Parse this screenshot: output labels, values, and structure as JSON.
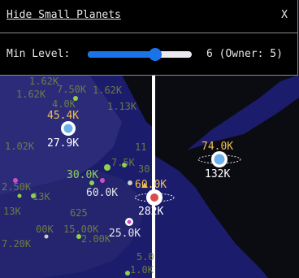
{
  "panel": {
    "title": "Hide Small Planets",
    "close": "X",
    "min_label": "Min Level:",
    "readout": "6 (Owner: 5)",
    "slider_fraction": 0.65
  },
  "colors": {
    "space_deep": "#0b0b12",
    "space_nebula": "#1c1c6c",
    "space_nebula_light": "#2b2b7a",
    "energy_label": "#f2c14e",
    "silver_label": "#ffffff",
    "faded_label": "#7b8a3a",
    "accent": "#1a73e8"
  },
  "planets": {
    "p1": {
      "energy": "45.4K",
      "silver": "27.9K"
    },
    "p2": {
      "energy": "74.0K",
      "silver": "132K"
    },
    "p3": {
      "energy": "60.0K",
      "silver": "282K"
    },
    "p4": {
      "silver": "30.0K"
    },
    "p5": {
      "silver": "60.0K"
    },
    "p6": {
      "silver": "25.0K"
    }
  },
  "background_labels": [
    "1.62K",
    "7.50K",
    "1.62K",
    "1.62K",
    "4.0K",
    "1.13K",
    "1.02K",
    "11",
    "7.5K",
    "30",
    "2.50K",
    "13K",
    "625",
    "13K",
    "00K",
    "15.00K",
    "7.20K",
    "5.0",
    "2.00K",
    "1.0K"
  ]
}
